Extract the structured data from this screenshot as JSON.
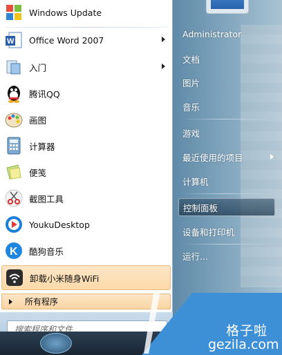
{
  "programs": [
    {
      "label": "Windows Update",
      "has_submenu": false
    },
    {
      "label": "Office Word 2007",
      "has_submenu": true
    },
    {
      "label": "入门",
      "has_submenu": true
    },
    {
      "label": "腾讯QQ",
      "has_submenu": false
    },
    {
      "label": "画图",
      "has_submenu": false
    },
    {
      "label": "计算器",
      "has_submenu": false
    },
    {
      "label": "便笺",
      "has_submenu": false
    },
    {
      "label": "截图工具",
      "has_submenu": false
    },
    {
      "label": "YoukuDesktop",
      "has_submenu": false
    },
    {
      "label": "酷狗音乐",
      "has_submenu": false
    },
    {
      "label": "卸载小米随身WiFi",
      "has_submenu": false,
      "highlighted": true
    }
  ],
  "all_programs_label": "所有程序",
  "search": {
    "placeholder": "搜索程序和文件"
  },
  "right_menu": {
    "user": "Administrator",
    "items": [
      {
        "label": "文档"
      },
      {
        "label": "图片"
      },
      {
        "label": "音乐"
      },
      {
        "label": "游戏"
      },
      {
        "label": "最近使用的项目",
        "has_submenu": true
      },
      {
        "label": "计算机"
      },
      {
        "label": "控制面板",
        "hovered": true
      },
      {
        "label": "设备和打印机"
      },
      {
        "label": "运行..."
      }
    ]
  },
  "watermark": {
    "cn": "格子啦",
    "en": "gezila.com"
  },
  "colors": {
    "highlight": "#fcd9a9",
    "watermark": "#3d8fd6",
    "right_pane": "#86a9c0"
  }
}
